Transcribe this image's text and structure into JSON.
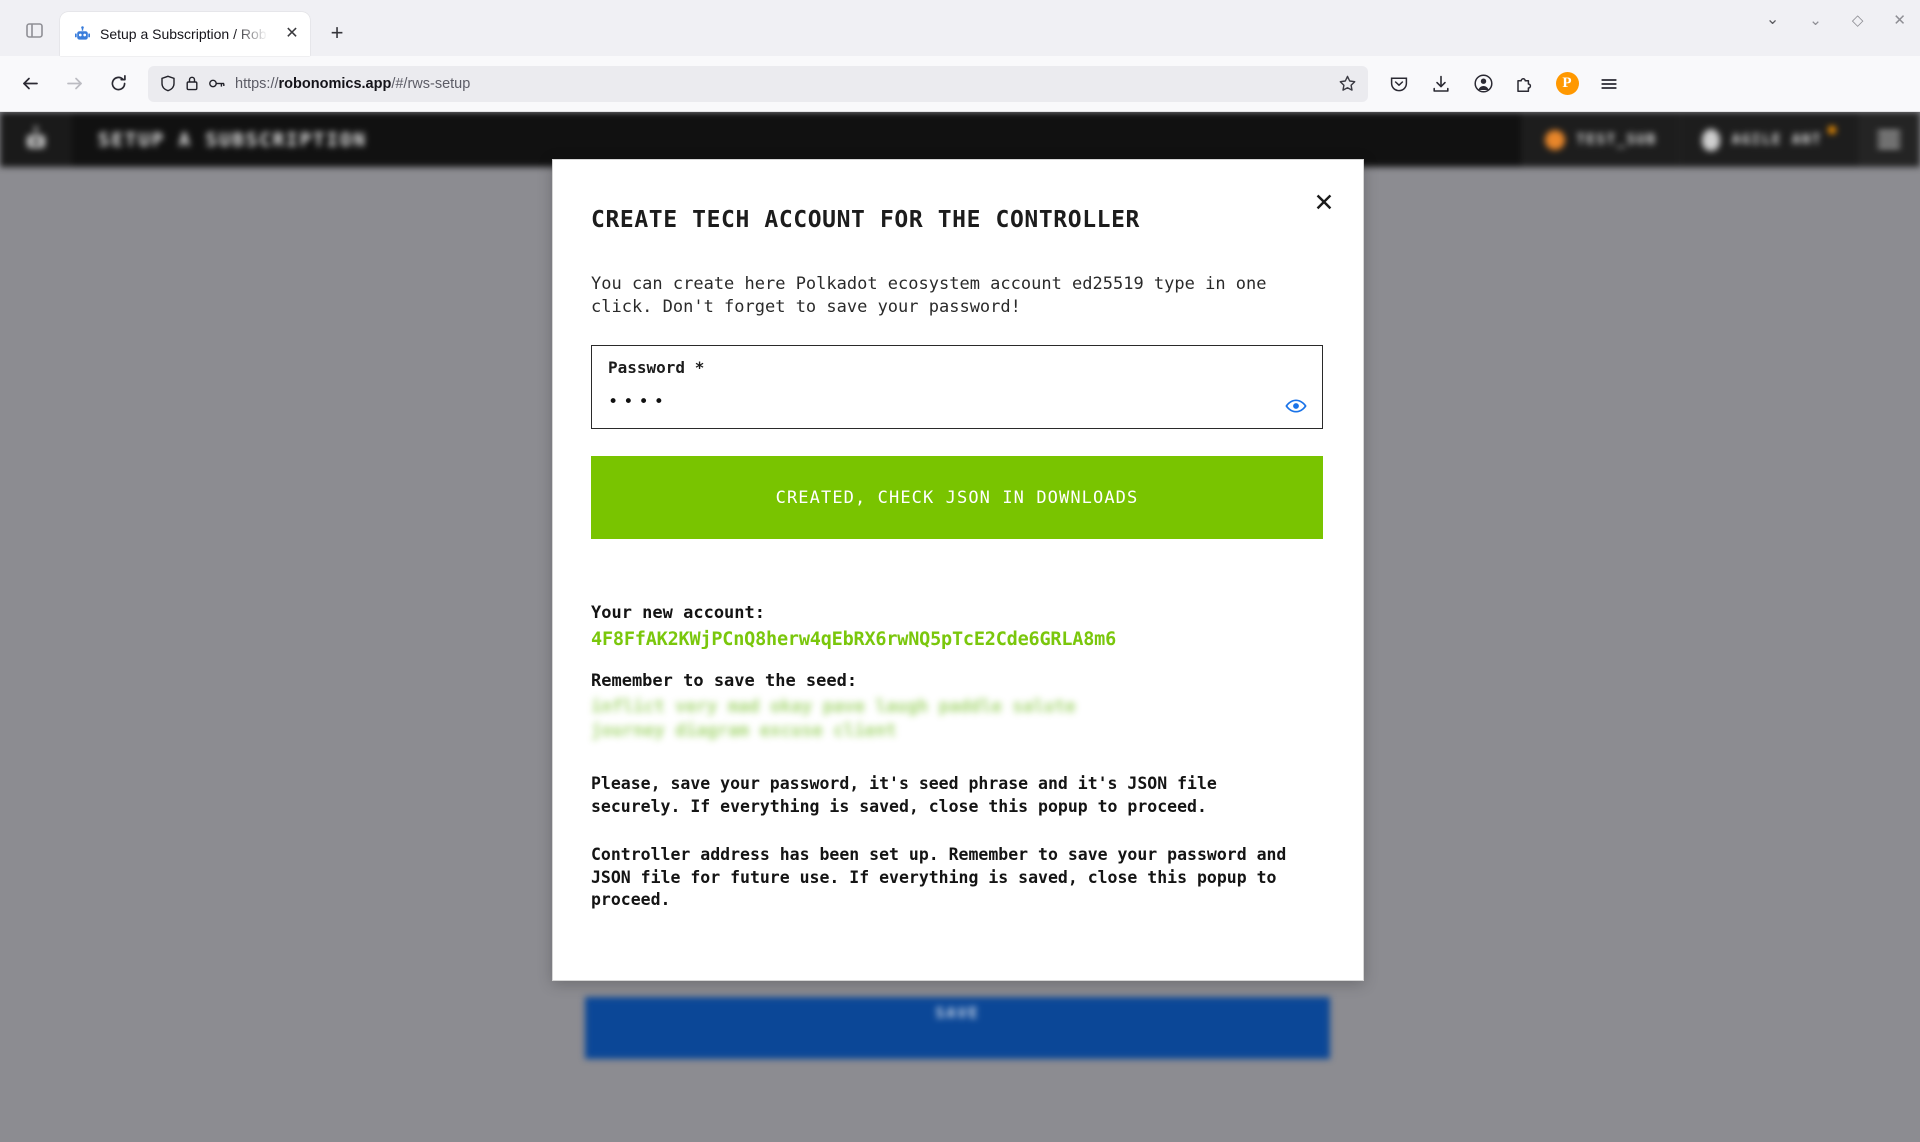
{
  "browser": {
    "tab": {
      "title": "Setup a Subscription / Rob",
      "favicon": "robot-icon",
      "close_label": "✕"
    },
    "new_tab_label": "+",
    "sidebar_icon": "sidebar-icon",
    "nav": {
      "back_label": "←",
      "forward_label": "→",
      "reload_label": "↻"
    },
    "url": {
      "protocol": "https://",
      "host": "robonomics.app",
      "path": "/#/rws-setup",
      "full": "https://robonomics.app/#/rws-setup",
      "shield_icon": "shield-icon",
      "lock_icon": "lock-icon",
      "key_icon": "key-icon",
      "bookmark_icon": "star-icon"
    },
    "toolbar_icons": [
      "pocket-icon",
      "downloads-icon",
      "account-icon",
      "extensions-icon",
      "polkadot-extension-icon",
      "app-menu-icon"
    ],
    "extension_badge_letter": "P",
    "window_controls": {
      "list_all_tabs": "⌄",
      "minimize": "⌄",
      "maximize": "◇",
      "close": "✕"
    }
  },
  "app": {
    "logo": "robonomics-logo",
    "title": "SETUP A SUBSCRIPTION",
    "account_chip": "TEST_SUB",
    "wallet_chip": "AGILE ANT",
    "menu_icon": "hamburger-menu-icon",
    "save_button": "SAVE"
  },
  "modal": {
    "title": "CREATE TECH ACCOUNT FOR THE CONTROLLER",
    "close_label": "✕",
    "description": "You can create here Polkadot ecosystem account ed25519 type in one click. Don't forget to save your password!",
    "password": {
      "label": "Password *",
      "value": "••••",
      "placeholder": "Password",
      "toggle_icon": "eye-icon"
    },
    "created_button": "CREATED, CHECK JSON IN DOWNLOADS",
    "account_label": "Your new account:",
    "account_address": "4F8FfAK2KWjPCnQ8herw4qEbRX6rwNQ5pTcE2Cde6GRLA8m6",
    "seed_label": "Remember to save the seed:",
    "seed_phrase": "inflict very mad okay pave laugh paddle salute journey diagram excuse client",
    "note_one": "Please, save your password, it's seed phrase and it's JSON file securely. If everything is saved, close this popup to proceed.",
    "note_two": "Controller address has been set up. Remember to save your password and JSON file for future use. If everything is saved, close this popup to proceed."
  },
  "colors": {
    "accent_green": "#79c400",
    "address_green": "#7ac70c",
    "save_blue": "#0b4797",
    "header_black": "#111111",
    "overlay_gray": "#8c8c91",
    "extension_orange": "#ff9800"
  }
}
